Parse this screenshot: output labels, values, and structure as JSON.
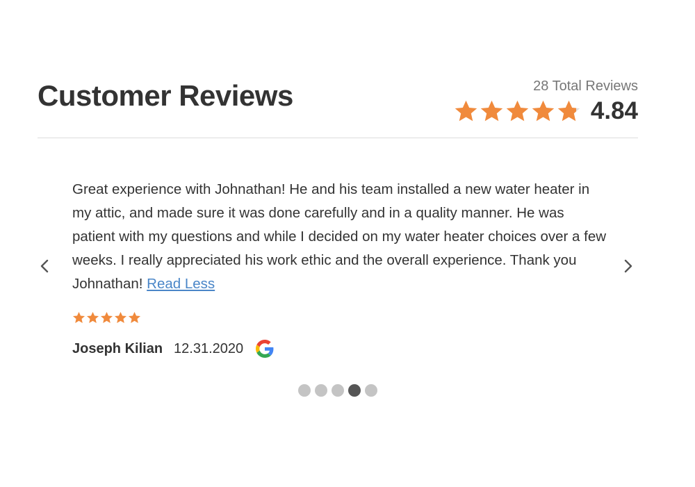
{
  "header": {
    "title": "Customer Reviews",
    "total_reviews": "28 Total Reviews",
    "average_rating": "4.84",
    "average_rating_value": 4.84,
    "star_color": "#f08a3c",
    "star_empty_color": "#e0e0e0"
  },
  "review": {
    "text": "Great experience with Johnathan! He and his team installed a new water heater in my attic, and made sure it was done carefully and in a quality manner. He was patient with my questions and while I decided on my water heater choices over a few weeks. I really appreciated his work ethic and the overall experience. Thank you Johnathan!",
    "toggle_label": "Read Less",
    "rating": 5,
    "reviewer": "Joseph Kilian",
    "date": "12.31.2020",
    "source_icon": "google-icon"
  },
  "carousel": {
    "prev_icon": "chevron-left-icon",
    "next_icon": "chevron-right-icon",
    "slide_count": 5,
    "active_slide": 4
  },
  "colors": {
    "link": "#4a86c8",
    "dot_inactive": "#c4c4c4",
    "dot_active": "#555555"
  }
}
